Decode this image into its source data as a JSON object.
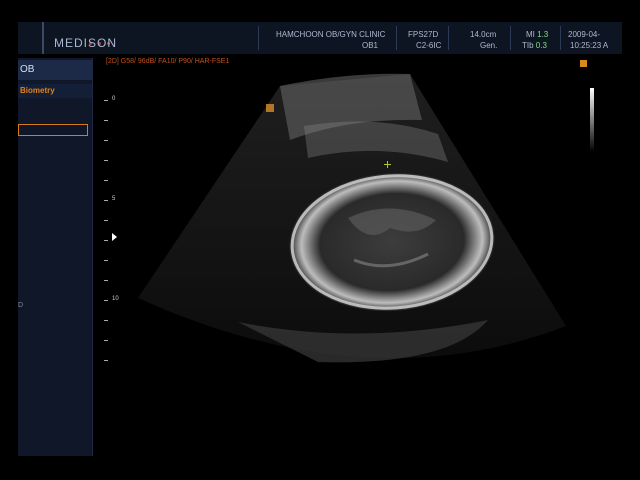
{
  "brand": {
    "logo": "MEDISON"
  },
  "header": {
    "clinic_name": "HAMCHOON OB/GYN CLINIC",
    "preset": "OB1",
    "frame_rate": "FPS27D",
    "probe": "C2-6IC",
    "depth": "14.0cm",
    "mode": "Gen.",
    "mi_label": "MI",
    "mi_value": "1.3",
    "tib_label": "TIb",
    "tib_value": "0.3",
    "date": "2009-04-",
    "time": "10:25:23 A"
  },
  "sidebar": {
    "title": "OB",
    "section": "Biometry",
    "marker": "D"
  },
  "image": {
    "mode_line": "[2D] G58/ 96dB/ FA10/ P90/ HAR-FSE1",
    "depth_labels": [
      "0",
      "5",
      "10"
    ]
  },
  "colors": {
    "accent_orange": "#d77a1c",
    "mi_green": "#7fe07f",
    "caliper": "#b4c82a"
  }
}
